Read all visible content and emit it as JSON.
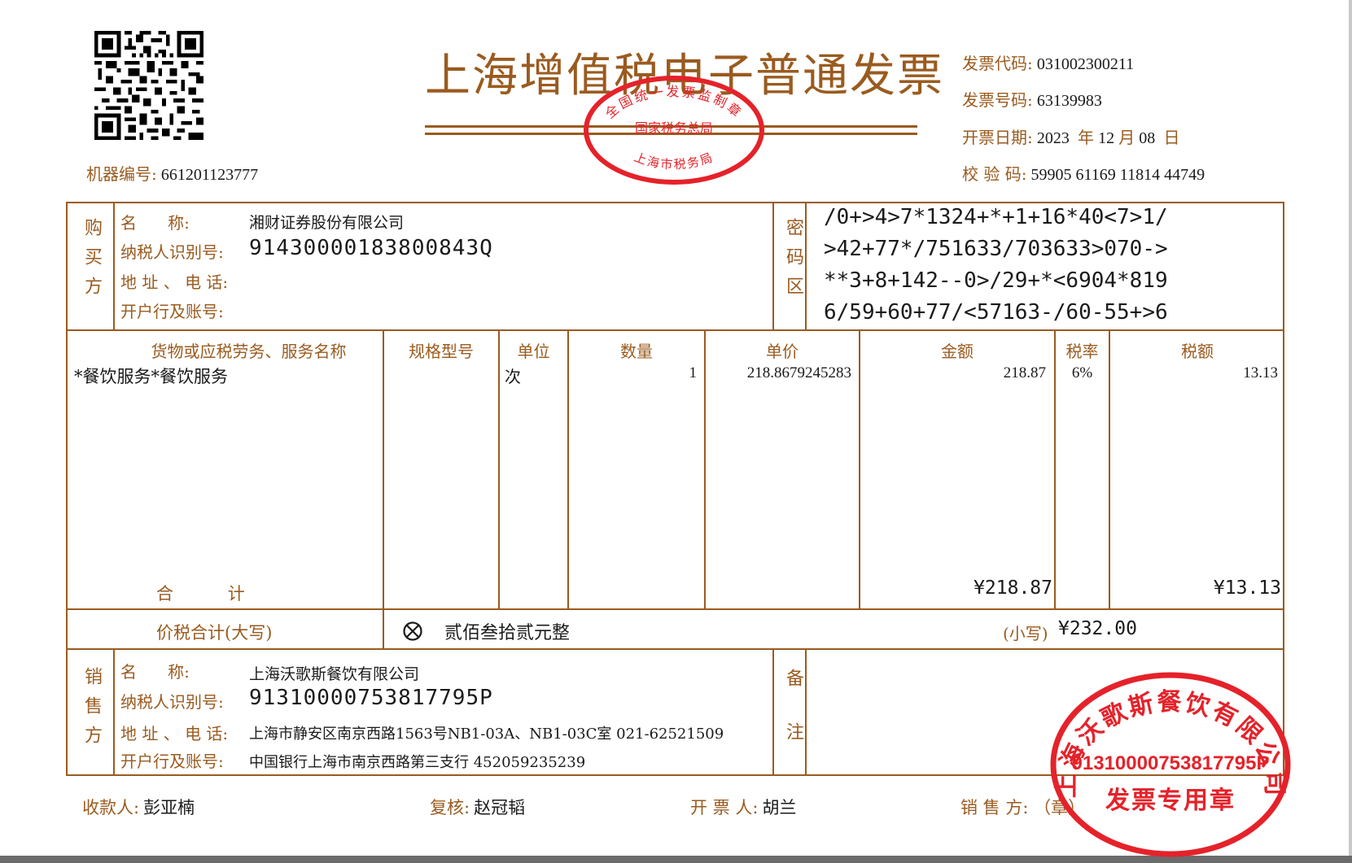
{
  "header": {
    "title": "上海增值税电子普通发票",
    "machine_no_label": "机器编号:",
    "machine_no": "661201123777",
    "invoice_code_label": "发票代码:",
    "invoice_code": "031002300211",
    "invoice_no_label": "发票号码:",
    "invoice_no": "63139983",
    "date_label": "开票日期:",
    "date_year": "2023",
    "date_year_unit": "年",
    "date_month": "12",
    "date_month_unit": "月",
    "date_day": "08",
    "date_day_unit": "日",
    "check_code_label": "校 验 码:",
    "check_code": "59905 61169 11814 44749"
  },
  "official_stamp": {
    "top_text": "全国统一发票监制章",
    "middle_text": "国家税务总局",
    "bottom_text": "上海市税务局"
  },
  "buyer": {
    "side_label": "购买方",
    "name_label": "名      称:",
    "name": "湘财证券股份有限公司",
    "tax_id_label": "纳税人识别号:",
    "tax_id": "91430000183800843Q",
    "address_label": "地 址 、 电 话:",
    "bank_label": "开户行及账号:"
  },
  "cipher": {
    "label": "密码区",
    "lines": [
      "/0+>4>7*1324+*+1+16*40<7>1/",
      ">42+77*/751633/703633>070->",
      "**3+8+142--0>/29+*<6904*819",
      "6/59+60+77/<57163-/60-55+>6"
    ]
  },
  "items": {
    "headers": {
      "name": "货物或应税劳务、服务名称",
      "spec": "规格型号",
      "unit": "单位",
      "qty": "数量",
      "price": "单价",
      "amount": "金额",
      "rate": "税率",
      "tax": "税额"
    },
    "rows": [
      {
        "name": "*餐饮服务*餐饮服务",
        "spec": "",
        "unit": "次",
        "qty": "1",
        "price": "218.8679245283",
        "amount": "218.87",
        "rate": "6%",
        "tax": "13.13"
      }
    ],
    "total_label": "合          计",
    "total_amount": "¥218.87",
    "total_tax": "¥13.13"
  },
  "grand_total": {
    "label": "价税合计(大写)",
    "words_icon": "cross-circle-icon",
    "words": "贰佰叁拾贰元整",
    "small_label": "(小写)",
    "small_value": "¥232.00"
  },
  "seller": {
    "side_label": "销售方",
    "name_label": "名      称:",
    "name": "上海沃歌斯餐饮有限公司",
    "tax_id_label": "纳税人识别号:",
    "tax_id": "91310000753817795P",
    "address_label": "地 址 、 电 话:",
    "address": "上海市静安区南京西路1563号NB1-03A、NB1-03C室 021-62521509",
    "bank_label": "开户行及账号:",
    "bank": "中国银行上海市南京西路第三支行 452059235239",
    "remark_label": "备注"
  },
  "footer": {
    "payee_label": "收款人:",
    "payee": "彭亚楠",
    "reviewer_label": "复核:",
    "reviewer": "赵冠韬",
    "drawer_label": "开 票 人:",
    "drawer": "胡兰",
    "seller_label": "销 售 方: （章）"
  },
  "seller_stamp": {
    "arc_text": "上海沃歌斯餐饮有限公司",
    "tax_id": "91310000753817795P",
    "bottom_text": "发票专用章"
  },
  "colors": {
    "frame": "#9a5b1f",
    "stamp": "#e5222a"
  }
}
